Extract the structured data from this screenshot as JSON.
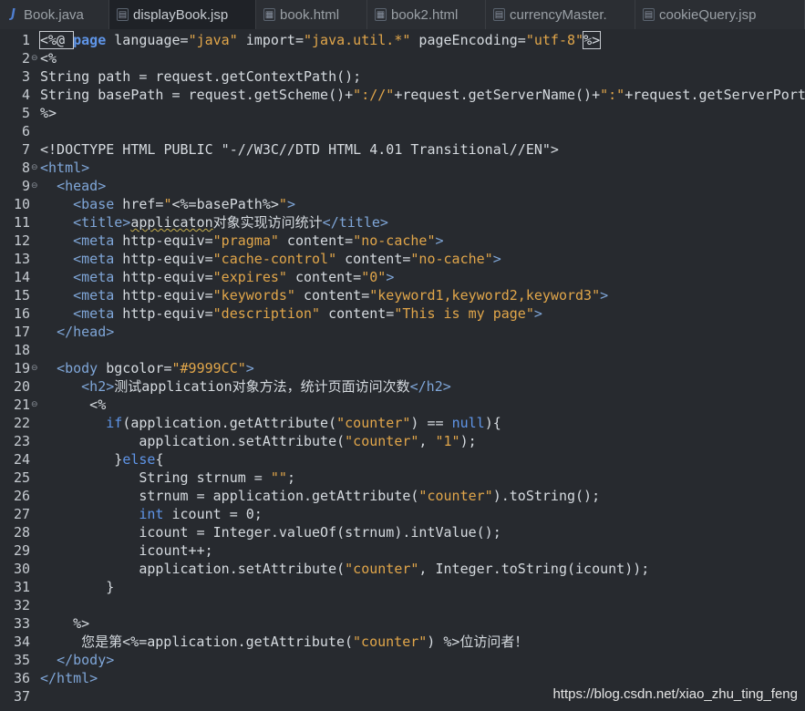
{
  "tabs": [
    {
      "label": "Book.java",
      "icon": "java-file-icon",
      "active": false
    },
    {
      "label": "displayBook.jsp",
      "icon": "jsp-file-icon",
      "active": true
    },
    {
      "label": "book.html",
      "icon": "html-file-icon",
      "active": false
    },
    {
      "label": "book2.html",
      "icon": "html-file-icon",
      "active": false
    },
    {
      "label": "currencyMaster.",
      "icon": "jsp-file-icon",
      "active": false
    },
    {
      "label": "cookieQuery.jsp",
      "icon": "jsp-file-icon",
      "active": false
    }
  ],
  "colors": {
    "editor_bg": "#272a2f",
    "keyword": "#5f95e8",
    "string": "#e1a64a",
    "tag": "#7fa6d8",
    "plain": "#d6dbe0"
  },
  "lines": [
    {
      "n": "1",
      "fold": "",
      "segs": [
        [
          "<%@ ",
          "dir"
        ],
        [
          "page",
          "kwb"
        ],
        [
          " language=",
          "attr"
        ],
        [
          "\"java\"",
          "str"
        ],
        [
          " import=",
          "attr"
        ],
        [
          "\"java.util.*\"",
          "str"
        ],
        [
          " pageEncoding=",
          "attr"
        ],
        [
          "\"utf-8\"",
          "str"
        ],
        [
          "%>",
          "dir"
        ]
      ]
    },
    {
      "n": "2",
      "fold": "⊖",
      "segs": [
        [
          "<%",
          "dir"
        ]
      ]
    },
    {
      "n": "3",
      "fold": "",
      "segs": [
        [
          "String path = request.getContextPath();",
          "pl"
        ]
      ]
    },
    {
      "n": "4",
      "fold": "",
      "segs": [
        [
          "String basePath = request.getScheme()+",
          "pl"
        ],
        [
          "\"://\"",
          "str"
        ],
        [
          "+request.getServerName()+",
          "pl"
        ],
        [
          "\":\"",
          "str"
        ],
        [
          "+request.getServerPort",
          "pl"
        ]
      ]
    },
    {
      "n": "5",
      "fold": "",
      "segs": [
        [
          "%>",
          "dir"
        ]
      ]
    },
    {
      "n": "6",
      "fold": "",
      "segs": []
    },
    {
      "n": "7",
      "fold": "",
      "segs": [
        [
          "<!DOCTYPE HTML PUBLIC \"-//W3C//DTD HTML 4.01 Transitional//EN\">",
          "pl"
        ]
      ]
    },
    {
      "n": "8",
      "fold": "⊖",
      "segs": [
        [
          "<html>",
          "tag"
        ]
      ]
    },
    {
      "n": "9",
      "fold": "⊖",
      "segs": [
        [
          "  ",
          "pl"
        ],
        [
          "<head>",
          "tag"
        ]
      ]
    },
    {
      "n": "10",
      "fold": "",
      "segs": [
        [
          "    ",
          "pl"
        ],
        [
          "<base",
          "tag"
        ],
        [
          " href=",
          "attr"
        ],
        [
          "\"",
          "str"
        ],
        [
          "<%=basePath%>",
          "pl"
        ],
        [
          "\"",
          "str"
        ],
        [
          ">",
          "tag"
        ]
      ]
    },
    {
      "n": "11",
      "fold": "",
      "segs": [
        [
          "    ",
          "pl"
        ],
        [
          "<title>",
          "tag"
        ],
        [
          "applicaton",
          "squig"
        ],
        [
          "对象实现访问统计",
          "pl"
        ],
        [
          "</title>",
          "tag"
        ]
      ]
    },
    {
      "n": "12",
      "fold": "",
      "segs": [
        [
          "    ",
          "pl"
        ],
        [
          "<meta",
          "tag"
        ],
        [
          " http-equiv=",
          "attr"
        ],
        [
          "\"pragma\"",
          "str"
        ],
        [
          " content=",
          "attr"
        ],
        [
          "\"no-cache\"",
          "str"
        ],
        [
          ">",
          "tag"
        ]
      ]
    },
    {
      "n": "13",
      "fold": "",
      "segs": [
        [
          "    ",
          "pl"
        ],
        [
          "<meta",
          "tag"
        ],
        [
          " http-equiv=",
          "attr"
        ],
        [
          "\"cache-control\"",
          "str"
        ],
        [
          " content=",
          "attr"
        ],
        [
          "\"no-cache\"",
          "str"
        ],
        [
          ">",
          "tag"
        ]
      ]
    },
    {
      "n": "14",
      "fold": "",
      "segs": [
        [
          "    ",
          "pl"
        ],
        [
          "<meta",
          "tag"
        ],
        [
          " http-equiv=",
          "attr"
        ],
        [
          "\"expires\"",
          "str"
        ],
        [
          " content=",
          "attr"
        ],
        [
          "\"0\"",
          "str"
        ],
        [
          ">",
          "tag"
        ]
      ]
    },
    {
      "n": "15",
      "fold": "",
      "segs": [
        [
          "    ",
          "pl"
        ],
        [
          "<meta",
          "tag"
        ],
        [
          " http-equiv=",
          "attr"
        ],
        [
          "\"keywords\"",
          "str"
        ],
        [
          " content=",
          "attr"
        ],
        [
          "\"keyword1,keyword2,keyword3\"",
          "str"
        ],
        [
          ">",
          "tag"
        ]
      ]
    },
    {
      "n": "16",
      "fold": "",
      "segs": [
        [
          "    ",
          "pl"
        ],
        [
          "<meta",
          "tag"
        ],
        [
          " http-equiv=",
          "attr"
        ],
        [
          "\"description\"",
          "str"
        ],
        [
          " content=",
          "attr"
        ],
        [
          "\"This is my page\"",
          "str"
        ],
        [
          ">",
          "tag"
        ]
      ]
    },
    {
      "n": "17",
      "fold": "",
      "segs": [
        [
          "  ",
          "pl"
        ],
        [
          "</head>",
          "tag"
        ]
      ]
    },
    {
      "n": "18",
      "fold": "",
      "segs": []
    },
    {
      "n": "19",
      "fold": "⊖",
      "segs": [
        [
          "  ",
          "pl"
        ],
        [
          "<body",
          "tag"
        ],
        [
          " bgcolor=",
          "attr"
        ],
        [
          "\"#9999CC\"",
          "str"
        ],
        [
          ">",
          "tag"
        ]
      ]
    },
    {
      "n": "20",
      "fold": "",
      "segs": [
        [
          "     ",
          "pl"
        ],
        [
          "<h2>",
          "tag"
        ],
        [
          "测试application对象方法，统计页面访问次数",
          "pl"
        ],
        [
          "</h2>",
          "tag"
        ]
      ]
    },
    {
      "n": "21",
      "fold": "⊖",
      "segs": [
        [
          "      <%",
          "pl"
        ]
      ]
    },
    {
      "n": "22",
      "fold": "",
      "segs": [
        [
          "        ",
          "pl"
        ],
        [
          "if",
          "kw"
        ],
        [
          "(application.getAttribute(",
          "pl"
        ],
        [
          "\"counter\"",
          "str"
        ],
        [
          ") == ",
          "pl"
        ],
        [
          "null",
          "kw"
        ],
        [
          "){",
          "pl"
        ]
      ]
    },
    {
      "n": "23",
      "fold": "",
      "segs": [
        [
          "            application.setAttribute(",
          "pl"
        ],
        [
          "\"counter\"",
          "str"
        ],
        [
          ", ",
          "pl"
        ],
        [
          "\"1\"",
          "str"
        ],
        [
          ");",
          "pl"
        ]
      ]
    },
    {
      "n": "24",
      "fold": "",
      "segs": [
        [
          "         }",
          "pl"
        ],
        [
          "else",
          "kw"
        ],
        [
          "{",
          "pl"
        ]
      ]
    },
    {
      "n": "25",
      "fold": "",
      "segs": [
        [
          "            String strnum = ",
          "pl"
        ],
        [
          "\"\"",
          "str"
        ],
        [
          ";",
          "pl"
        ]
      ]
    },
    {
      "n": "26",
      "fold": "",
      "segs": [
        [
          "            strnum = application.getAttribute(",
          "pl"
        ],
        [
          "\"counter\"",
          "str"
        ],
        [
          ").toString();",
          "pl"
        ]
      ]
    },
    {
      "n": "27",
      "fold": "",
      "segs": [
        [
          "            ",
          "pl"
        ],
        [
          "int",
          "kw"
        ],
        [
          " icount = 0;",
          "pl"
        ]
      ]
    },
    {
      "n": "28",
      "fold": "",
      "segs": [
        [
          "            icount = Integer.valueOf(strnum).intValue();",
          "pl"
        ]
      ]
    },
    {
      "n": "29",
      "fold": "",
      "segs": [
        [
          "            icount++;",
          "pl"
        ]
      ]
    },
    {
      "n": "30",
      "fold": "",
      "segs": [
        [
          "            application.setAttribute(",
          "pl"
        ],
        [
          "\"counter\"",
          "str"
        ],
        [
          ", Integer.toString(icount));",
          "pl"
        ]
      ]
    },
    {
      "n": "31",
      "fold": "",
      "segs": [
        [
          "        }",
          "pl"
        ]
      ]
    },
    {
      "n": "32",
      "fold": "",
      "segs": []
    },
    {
      "n": "33",
      "fold": "",
      "segs": [
        [
          "    %>",
          "pl"
        ]
      ]
    },
    {
      "n": "34",
      "fold": "",
      "segs": [
        [
          "     您是第<%=application.getAttribute(",
          "pl"
        ],
        [
          "\"counter\"",
          "str"
        ],
        [
          ") %>位访问者！",
          "pl"
        ]
      ]
    },
    {
      "n": "35",
      "fold": "",
      "segs": [
        [
          "  ",
          "pl"
        ],
        [
          "</body>",
          "tag"
        ]
      ]
    },
    {
      "n": "36",
      "fold": "",
      "segs": [
        [
          "</html>",
          "tag"
        ]
      ]
    },
    {
      "n": "37",
      "fold": "",
      "segs": []
    }
  ],
  "watermark": "https://blog.csdn.net/xiao_zhu_ting_feng"
}
